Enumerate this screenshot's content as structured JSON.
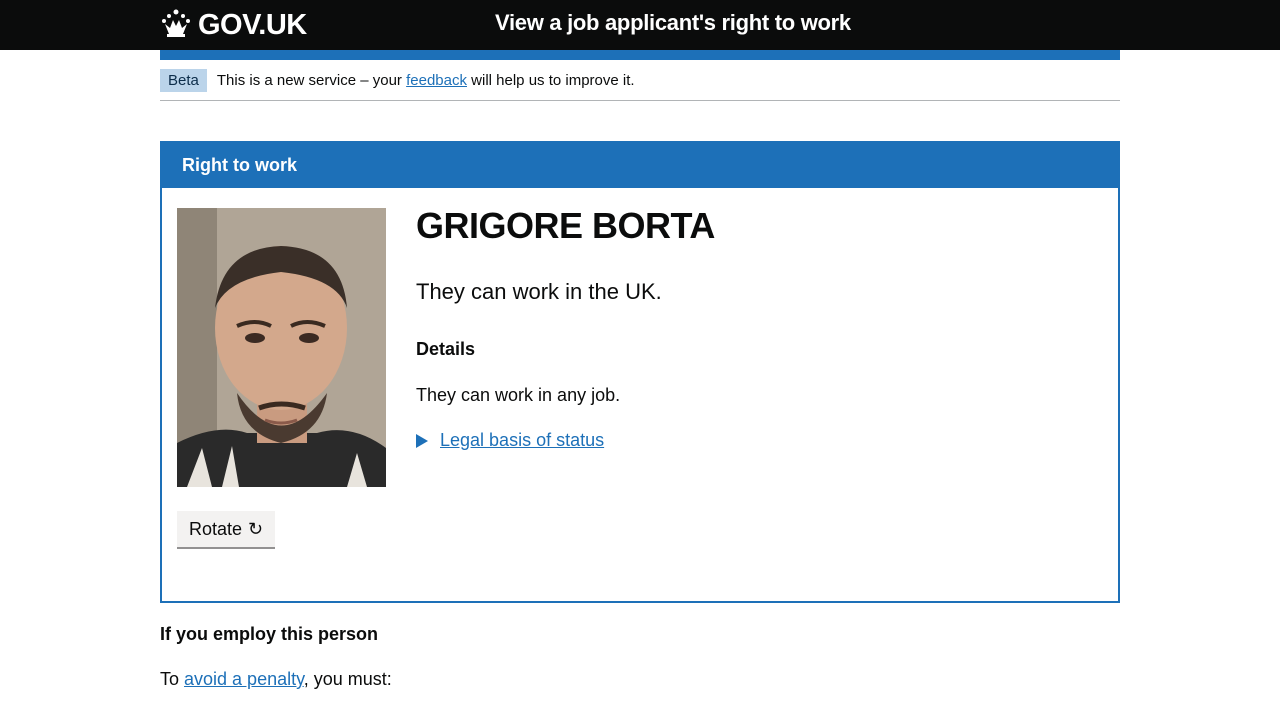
{
  "header": {
    "logo_text": "GOV.UK",
    "service_name": "View a job applicant's right to work"
  },
  "beta_banner": {
    "tag": "Beta",
    "text_before": "This is a new service – your ",
    "link_text": "feedback",
    "text_after": " will help us to improve it."
  },
  "panel": {
    "title": "Right to work",
    "person_name": "GRIGORE BORTA",
    "status": "They can work in the UK.",
    "details_heading": "Details",
    "details_text": "They can work in any job.",
    "legal_link": "Legal basis of status",
    "rotate_label": "Rotate",
    "rotate_icon": "↻"
  },
  "employ": {
    "heading": "If you employ this person",
    "text_before": "To ",
    "link_text": "avoid a penalty",
    "text_after": ", you must:"
  },
  "colors": {
    "brand_blue": "#1d70b8",
    "header_black": "#0b0c0c",
    "beta_tag": "#bbd4ea"
  }
}
